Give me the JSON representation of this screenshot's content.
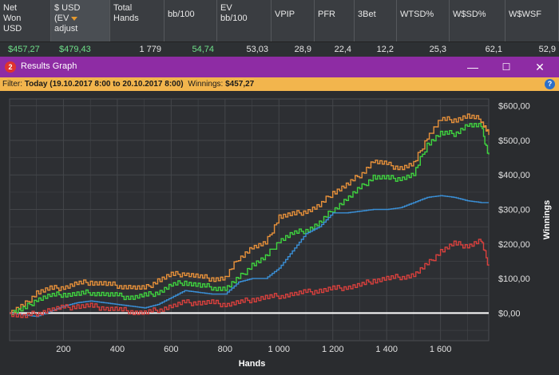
{
  "stats": {
    "headers": [
      {
        "label": "Net Won USD",
        "lines": [
          "Net",
          "Won",
          "USD"
        ]
      },
      {
        "label": "$ USD (EV adjust",
        "lines": [
          "$ USD",
          "(EV",
          "adjust"
        ],
        "sorted": true
      },
      {
        "label": "Total Hands",
        "lines": [
          "Total",
          "Hands"
        ]
      },
      {
        "label": "bb/100",
        "lines": [
          "bb/100"
        ]
      },
      {
        "label": "EV bb/100",
        "lines": [
          "EV",
          "bb/100"
        ]
      },
      {
        "label": "VPIP",
        "lines": [
          "VPIP"
        ]
      },
      {
        "label": "PFR",
        "lines": [
          "PFR"
        ]
      },
      {
        "label": "3Bet",
        "lines": [
          "3Bet"
        ]
      },
      {
        "label": "WTSD%",
        "lines": [
          "WTSD%"
        ]
      },
      {
        "label": "W$SD%",
        "lines": [
          "W$SD%"
        ]
      },
      {
        "label": "W$WSF",
        "lines": [
          "W$WSF"
        ]
      }
    ],
    "values": [
      "$457,27",
      "$479,43",
      "1 779",
      "54,74",
      "53,03",
      "28,9",
      "22,4",
      "12,2",
      "25,3",
      "62,1",
      "52,9"
    ]
  },
  "window": {
    "badge": "2",
    "title": "Results Graph",
    "minimize": "—",
    "maximize": "☐",
    "close": "✕"
  },
  "filter": {
    "prefix": "Filter: ",
    "range": "Today (19.10.2017 8:00 to 20.10.2017 8:00)",
    "winnings_label": "Winnings: ",
    "winnings_value": "$457,27",
    "help": "?"
  },
  "colors": {
    "orange": "#e8913a",
    "green": "#3fd43f",
    "blue": "#3a8fd6",
    "red": "#d9403d",
    "zero_line": "#ffffff",
    "grid": "#43464a"
  },
  "chart_data": {
    "type": "line",
    "xlabel": "Hands",
    "ylabel": "Winnings",
    "xlim": [
      0,
      1779
    ],
    "ylim": [
      -80,
      620
    ],
    "xticks": [
      200,
      400,
      600,
      800,
      1000,
      1200,
      1400,
      1600
    ],
    "xtick_labels": [
      "200",
      "400",
      "600",
      "800",
      "1 000",
      "1 200",
      "1 400",
      "1 600"
    ],
    "yticks": [
      0,
      100,
      200,
      300,
      400,
      500,
      600
    ],
    "ytick_labels": [
      "$0,00",
      "$100,00",
      "$200,00",
      "$300,00",
      "$400,00",
      "$500,00",
      "$600,00"
    ],
    "x": [
      0,
      50,
      100,
      150,
      200,
      250,
      300,
      350,
      400,
      450,
      500,
      550,
      600,
      650,
      700,
      750,
      800,
      850,
      900,
      950,
      1000,
      1050,
      1100,
      1150,
      1200,
      1250,
      1300,
      1350,
      1400,
      1450,
      1500,
      1550,
      1600,
      1650,
      1700,
      1750,
      1779
    ],
    "series": [
      {
        "color_key": "orange",
        "values": [
          0,
          20,
          60,
          70,
          75,
          85,
          90,
          85,
          80,
          75,
          70,
          95,
          110,
          115,
          105,
          100,
          100,
          160,
          190,
          200,
          280,
          285,
          295,
          310,
          350,
          370,
          400,
          440,
          430,
          420,
          430,
          510,
          560,
          560,
          570,
          560,
          520
        ]
      },
      {
        "color_key": "green",
        "values": [
          0,
          10,
          40,
          50,
          55,
          55,
          60,
          55,
          50,
          45,
          50,
          60,
          80,
          90,
          80,
          75,
          70,
          100,
          140,
          160,
          210,
          230,
          240,
          260,
          300,
          330,
          360,
          395,
          390,
          390,
          400,
          490,
          520,
          520,
          545,
          540,
          455
        ]
      },
      {
        "color_key": "blue",
        "values": [
          0,
          -5,
          -10,
          5,
          20,
          30,
          35,
          30,
          25,
          20,
          15,
          25,
          45,
          65,
          60,
          55,
          55,
          90,
          100,
          100,
          130,
          180,
          230,
          250,
          290,
          290,
          295,
          300,
          300,
          305,
          320,
          335,
          340,
          335,
          325,
          320,
          320
        ]
      },
      {
        "color_key": "red",
        "values": [
          0,
          -10,
          0,
          10,
          15,
          20,
          20,
          15,
          10,
          5,
          0,
          10,
          20,
          30,
          30,
          30,
          25,
          30,
          40,
          45,
          50,
          55,
          60,
          65,
          70,
          75,
          80,
          95,
          100,
          105,
          110,
          140,
          180,
          200,
          195,
          210,
          135
        ]
      }
    ]
  }
}
